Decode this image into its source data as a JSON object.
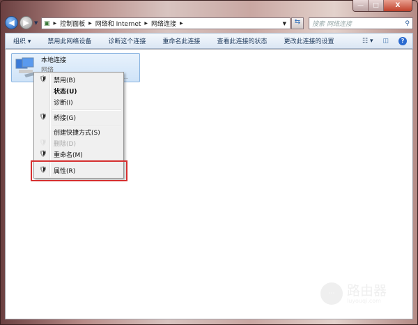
{
  "window": {
    "minimize": "—",
    "maximize": "□",
    "close": "X"
  },
  "address": {
    "crumbs": [
      "控制面板",
      "网络和 Internet",
      "网络连接"
    ]
  },
  "search": {
    "placeholder": "搜索 网络连接"
  },
  "toolbar": {
    "items": [
      "组织 ▾",
      "禁用此网络设备",
      "诊断这个连接",
      "重命名此连接",
      "查看此连接的状态",
      "更改此连接的设置"
    ]
  },
  "connection": {
    "name": "本地连接",
    "status": "网络",
    "device": "ol..."
  },
  "context_menu": {
    "items": [
      {
        "label": "禁用(B)",
        "shield": true
      },
      {
        "label": "状态(U)",
        "bold": true
      },
      {
        "label": "诊断(I)"
      },
      {
        "label": "桥接(G)",
        "shield": true
      },
      {
        "label": "创建快捷方式(S)"
      },
      {
        "label": "删除(D)",
        "shield": true,
        "disabled": true
      },
      {
        "label": "重命名(M)",
        "shield": true
      },
      {
        "label": "属性(R)",
        "shield": true,
        "highlighted": true
      }
    ]
  },
  "watermark": {
    "title": "路由器",
    "url": "luyouqi.com"
  }
}
